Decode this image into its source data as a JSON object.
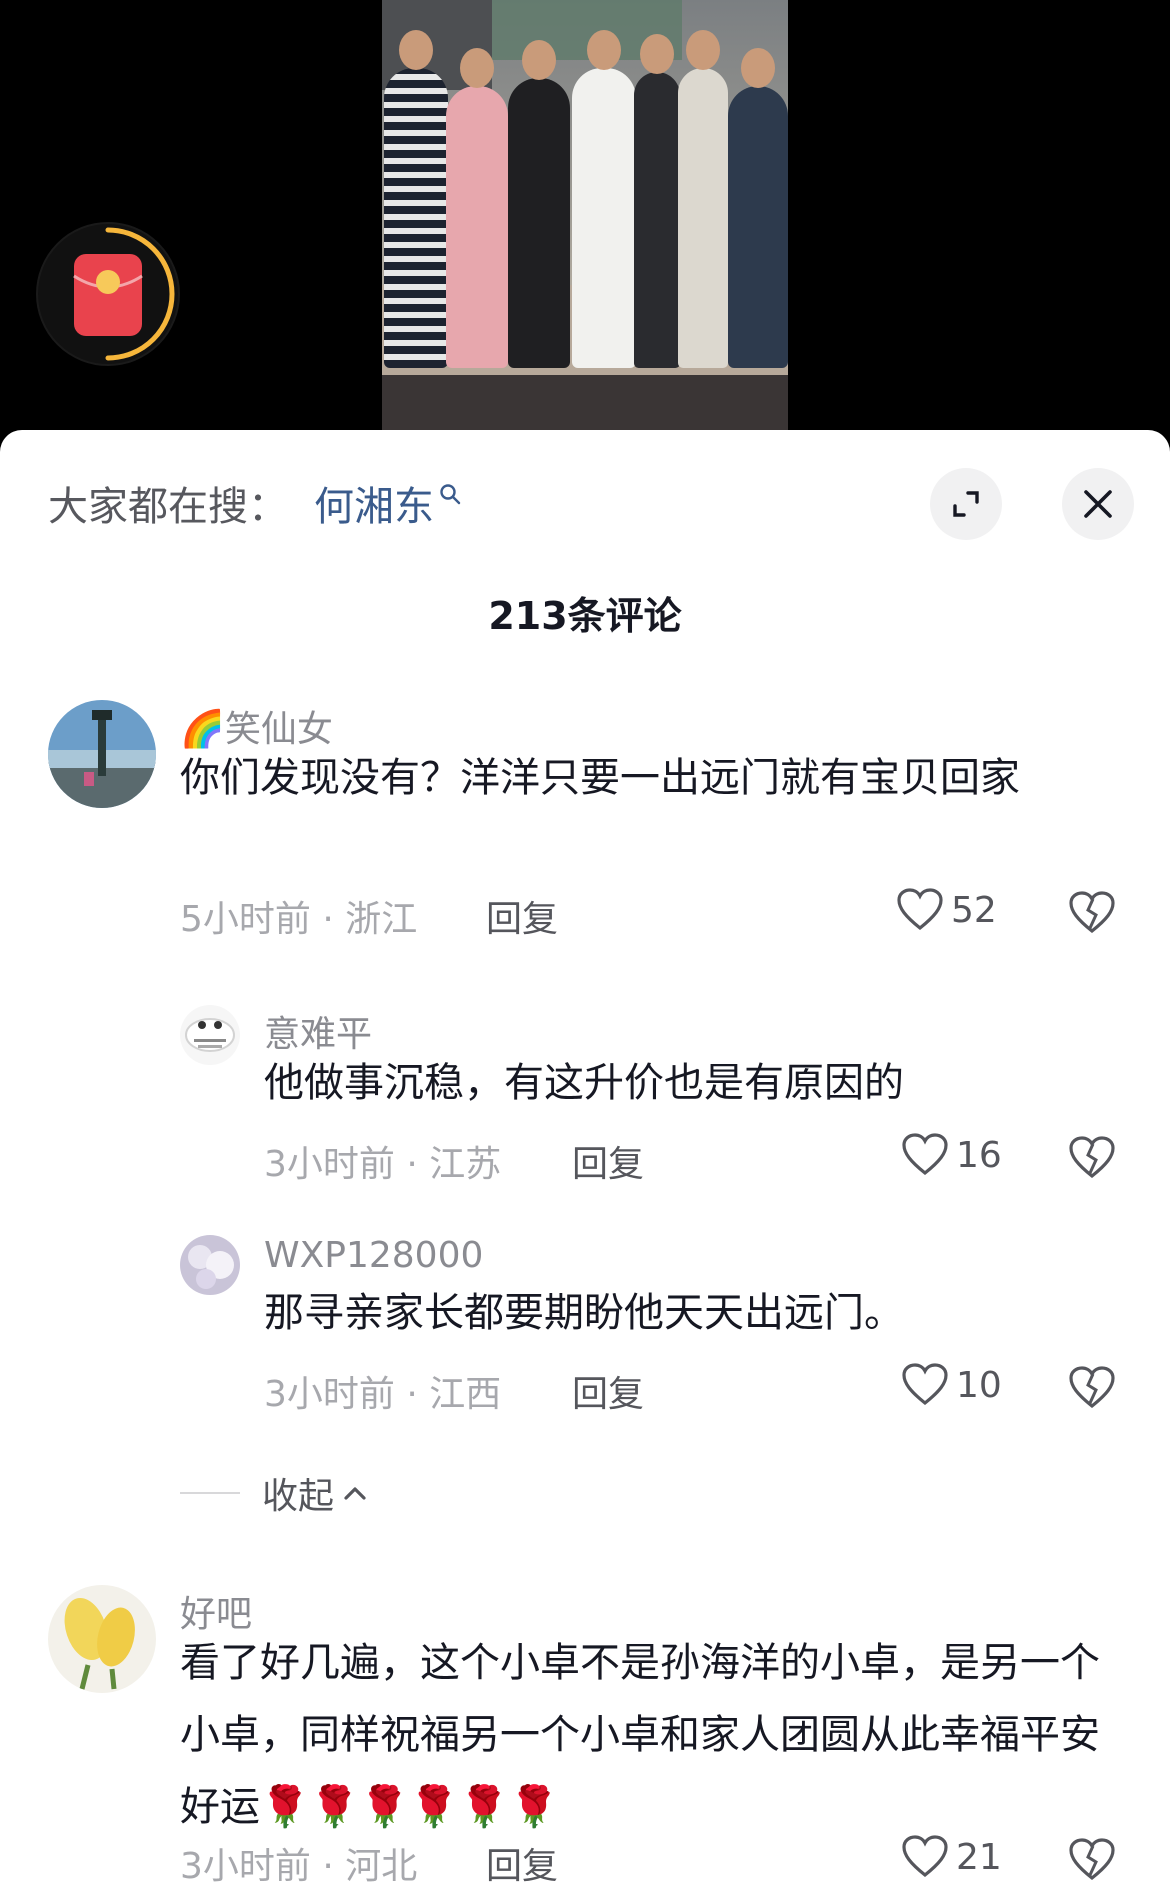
{
  "search": {
    "prefix": "大家都在搜：",
    "term": "何湘东"
  },
  "header": {
    "comment_count": "213条评论"
  },
  "comments": [
    {
      "user": "笑仙女",
      "emoji": "🌈",
      "text": "你们发现没有？洋洋只要一出远门就有宝贝回家",
      "time_location": "5小时前 · 浙江",
      "reply": "回复",
      "likes": "52"
    },
    {
      "user": "意难平",
      "text": "他做事沉稳，有这升价也是有原因的",
      "time_location": "3小时前 · 江苏",
      "reply": "回复",
      "likes": "16"
    },
    {
      "user": "WXP128000",
      "text": "那寻亲家长都要期盼他天天出远门。",
      "time_location": "3小时前 · 江西",
      "reply": "回复",
      "likes": "10"
    },
    {
      "user": "好吧",
      "text": "看了好几遍，这个小卓不是孙海洋的小卓，是另一个小卓，同样祝福另一个小卓和家人团圆从此幸福平安好运🌹🌹🌹🌹🌹🌹",
      "time_location": "3小时前 · 河北",
      "reply": "回复",
      "likes": "21"
    }
  ],
  "collapse": {
    "label": "收起"
  },
  "colors": {
    "accent_link": "#3a5b8c",
    "red_packet": "#e9434d",
    "ring": "#f6b63b"
  }
}
